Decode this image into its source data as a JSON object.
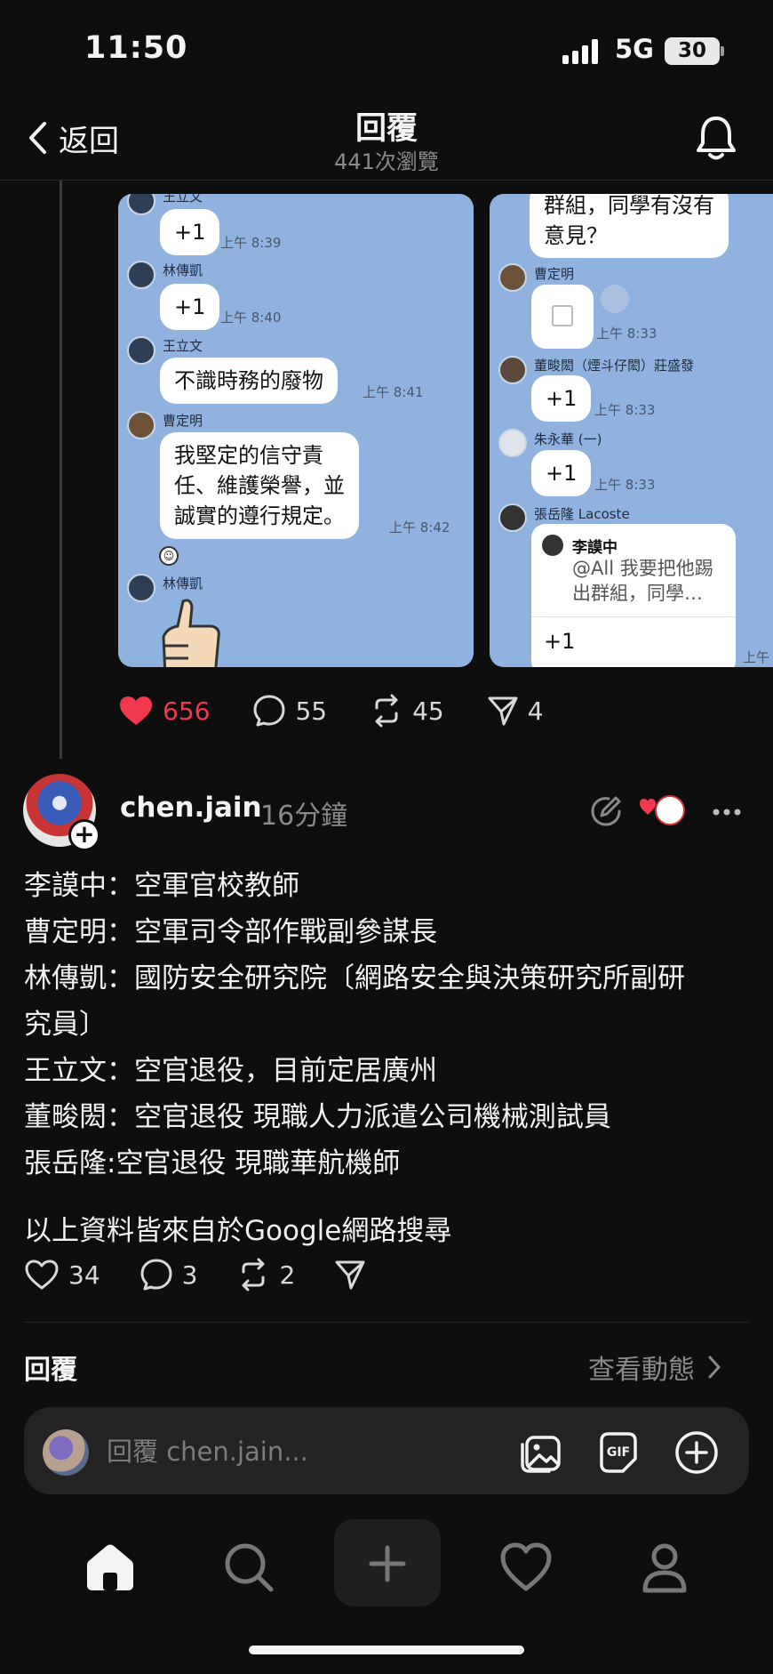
{
  "status": {
    "time": "11:50",
    "network": "5G",
    "battery": "30"
  },
  "header": {
    "back_label": "返回",
    "title": "回覆",
    "views": "441次瀏覽"
  },
  "shot1": {
    "messages": [
      {
        "name": "王立文",
        "text": "+1",
        "time": "上午 8:39"
      },
      {
        "name": "林傳凱",
        "text": "+1",
        "time": "上午 8:40"
      },
      {
        "name": "王立文",
        "text": "不識時務的廢物",
        "time": "上午 8:41"
      },
      {
        "name": "曹定明",
        "lines": [
          "我堅定的信守責",
          "任、維護榮譽，並",
          "誠實的遵行規定。"
        ],
        "time": "上午 8:42"
      },
      {
        "name": "林傳凱"
      }
    ]
  },
  "shot2": {
    "top_bubble_lines": [
      "群組，同學有沒有",
      "意見？"
    ],
    "messages": [
      {
        "name": "曹定明",
        "time": "上午 8:33"
      },
      {
        "name": "董畯閎（煙斗仔閎）莊盛發",
        "text": "+1",
        "time": "上午 8:33"
      },
      {
        "name": "朱永華 (一)",
        "text": "+1",
        "time": "上午 8:33"
      },
      {
        "name": "張岳隆 Lacoste",
        "quote_name": "李謨中",
        "quote_lines": [
          "@All 我要把他踢",
          "出群組，同學…"
        ],
        "text": "+1",
        "time": "上午"
      }
    ]
  },
  "parent_actions": {
    "likes": "656",
    "comments": "55",
    "reposts": "45",
    "shares": "4"
  },
  "post": {
    "username": "chen.jain",
    "time": "16分鐘",
    "lines": [
      "李謨中：空軍官校教師",
      "曹定明：空軍司令部作戰副參謀長",
      "林傳凱：國防安全研究院〔網路安全與決策研究所副研",
      "究員〕",
      "王立文：空官退役，目前定居廣州",
      "董畯閎：空官退役 現職人力派遣公司機械測試員",
      "張岳隆:空官退役 現職華航機師"
    ],
    "footer_line": "以上資料皆來自於Google網路搜尋",
    "likes": "34",
    "comments": "3",
    "reposts": "2"
  },
  "replies": {
    "title": "回覆",
    "view_activity": "查看動態"
  },
  "composer": {
    "placeholder": "回覆 chen.jain..."
  },
  "icons": {
    "back": "chevron-left-icon",
    "bell": "bell-icon",
    "like": "heart-icon",
    "comment": "comment-icon",
    "repost": "repost-icon",
    "share": "send-icon",
    "edit": "edit-icon",
    "more": "more-icon",
    "image": "image-icon",
    "gif": "gif-icon",
    "add": "plus-circle-icon",
    "home": "home-icon",
    "search": "search-icon",
    "create": "plus-icon",
    "activity": "heart-icon",
    "profile": "profile-icon"
  },
  "colors": {
    "background": "#0e0e0e",
    "liked": "#f0384e",
    "chat_bg": "#8fb3de",
    "muted": "#8a8a8a"
  }
}
